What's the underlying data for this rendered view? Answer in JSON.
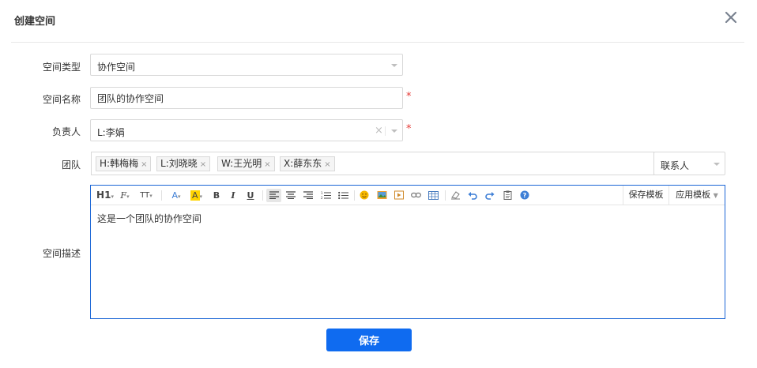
{
  "dialog": {
    "title": "创建空间",
    "close_glyph": "✕"
  },
  "form": {
    "space_type": {
      "label": "空间类型",
      "value": "协作空间"
    },
    "space_name": {
      "label": "空间名称",
      "value": "团队的协作空间",
      "required": "*"
    },
    "owner": {
      "label": "负责人",
      "value": "L:李娟",
      "clear": "×",
      "required": "*"
    },
    "team": {
      "label": "团队",
      "members": [
        "H:韩梅梅",
        "L:刘晓晓",
        "W:王光明",
        "X:薛东东"
      ],
      "remove_glyph": "×",
      "contact_select": "联系人"
    },
    "description": {
      "label": "空间描述",
      "content": "这是一个团队的协作空间",
      "toolbar": {
        "heading": "H1",
        "font_family": "F",
        "font_size": "TT",
        "font_color": "A",
        "bg_color": "A",
        "bold": "B",
        "italic": "I",
        "underline": "U",
        "save_template": "保存模板",
        "apply_template": "应用模板"
      }
    }
  },
  "actions": {
    "save_label": "保存"
  },
  "icons": [
    "close-icon",
    "chevron-down-icon",
    "clear-icon",
    "align-left-icon",
    "align-center-icon",
    "align-right-icon",
    "ordered-list-icon",
    "unordered-list-icon",
    "emoji-icon",
    "image-icon",
    "video-icon",
    "link-icon",
    "table-icon",
    "eraser-icon",
    "undo-icon",
    "redo-icon",
    "paste-icon",
    "help-icon"
  ],
  "colors": {
    "primary": "#0f6bf0",
    "required": "#e53935",
    "editor_border": "#1b66d6",
    "highlight": "#ffd400"
  }
}
